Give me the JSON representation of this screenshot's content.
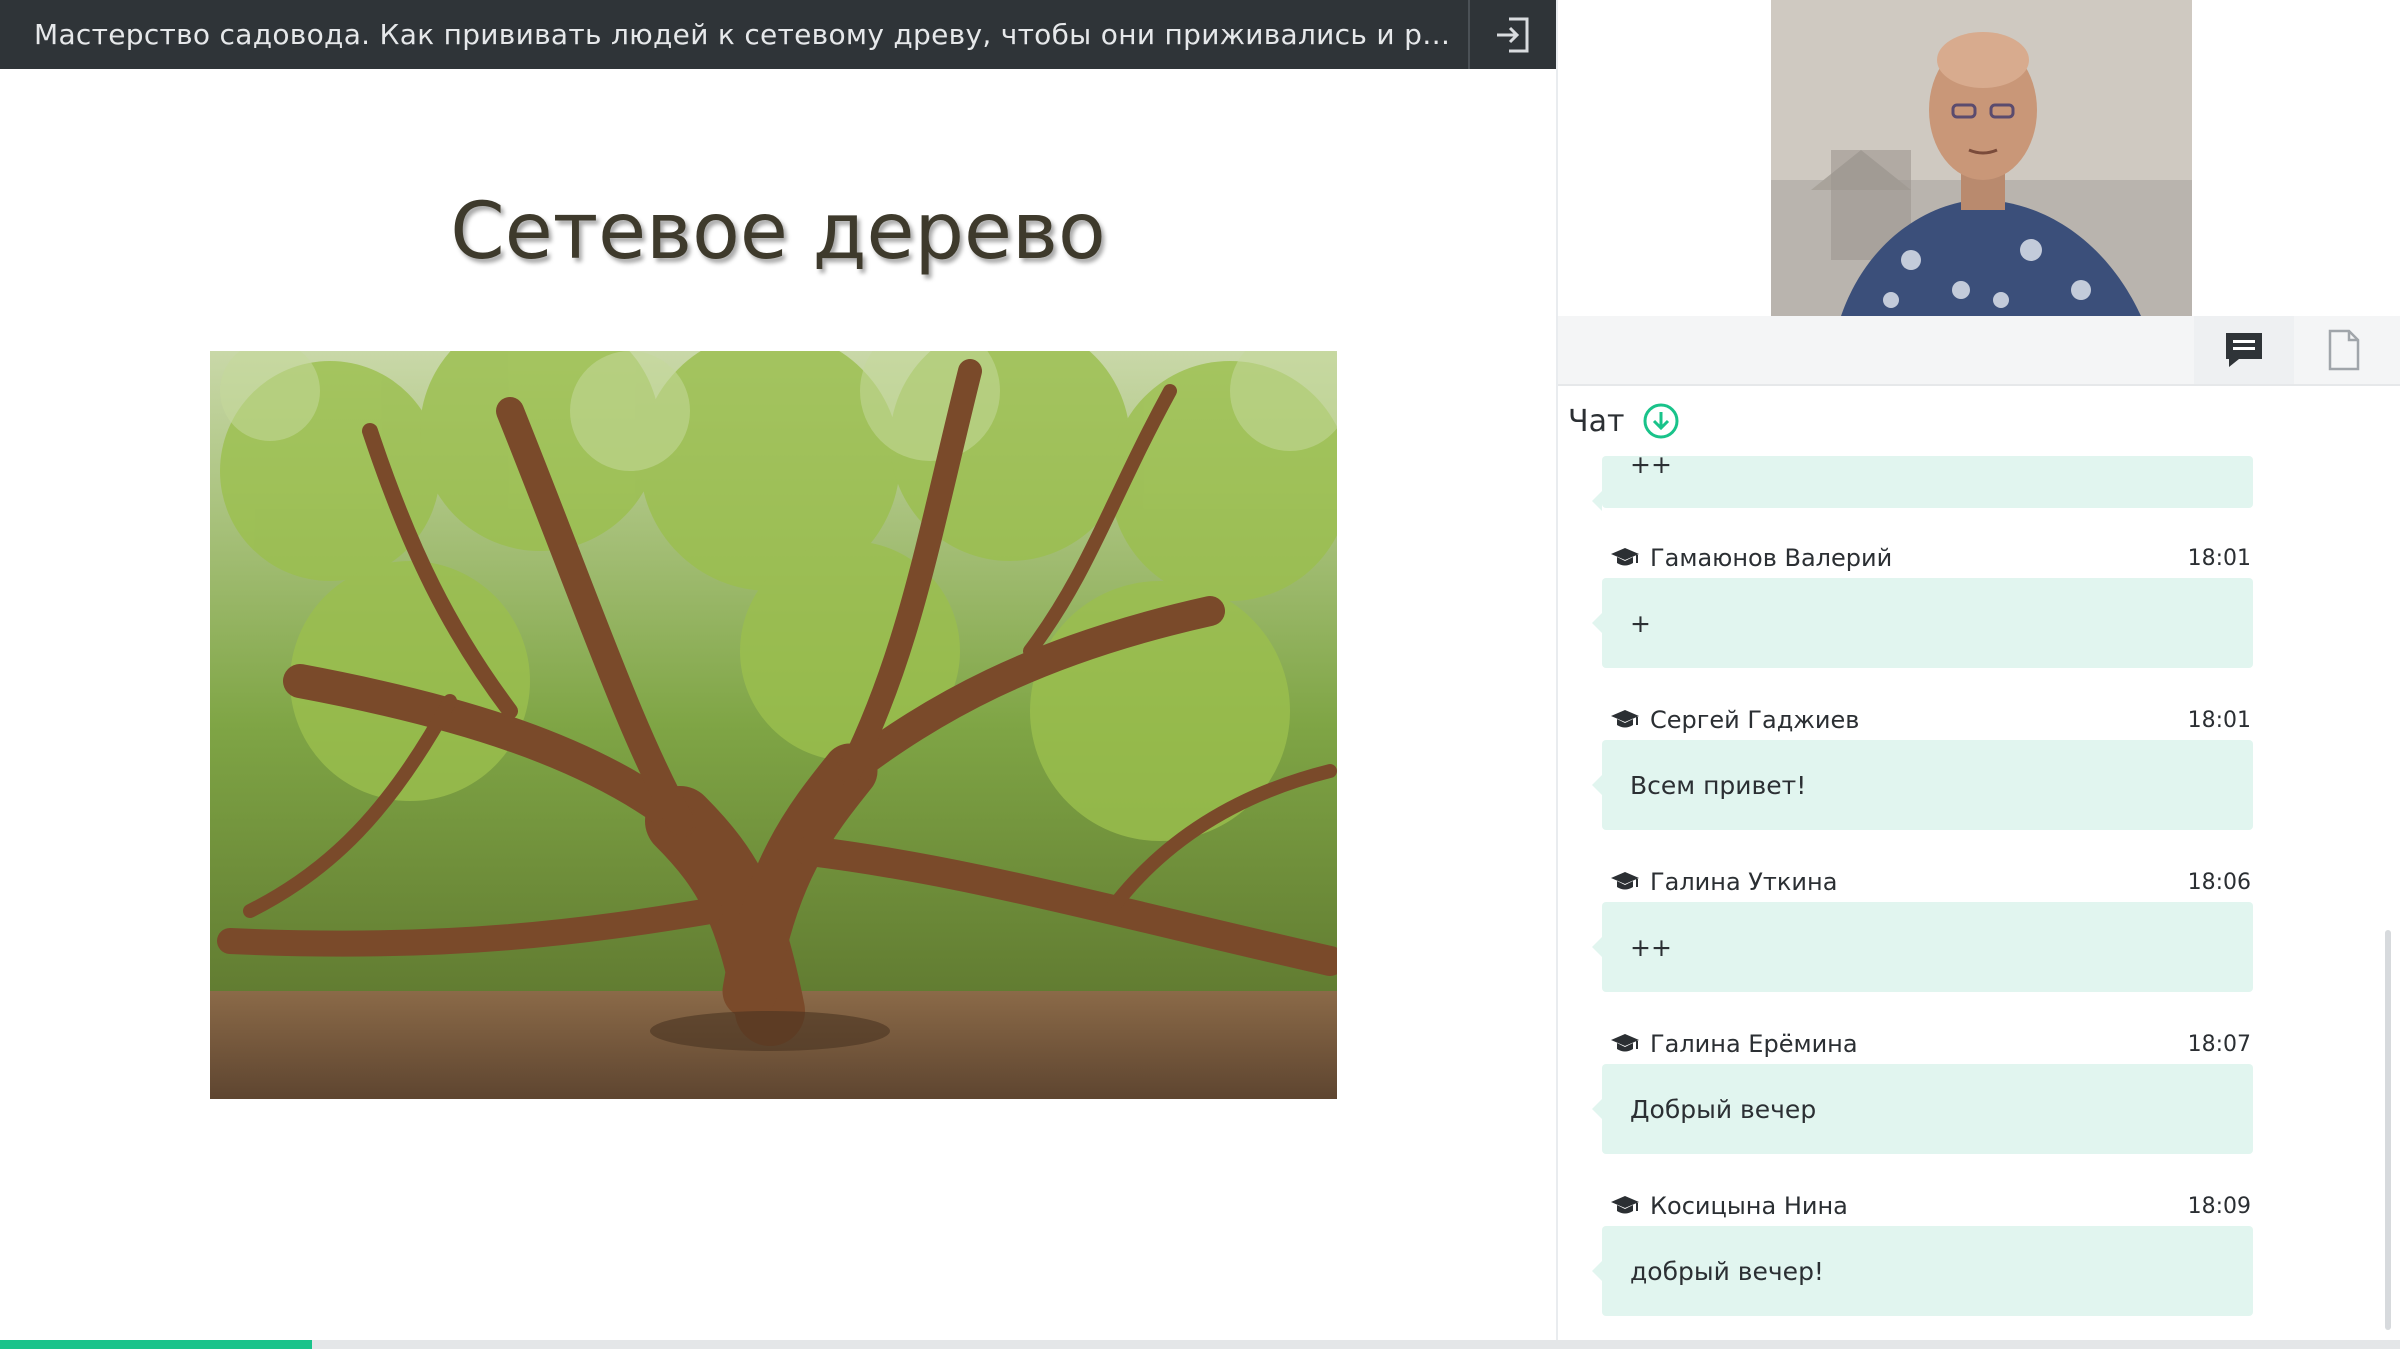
{
  "header": {
    "title": "Мастерство садовода. Как прививать людей к сетевому древу, чтобы они приживались и ра...",
    "exit_icon": "exit-icon"
  },
  "slide": {
    "title": "Сетевое дерево",
    "image": "tree-photo"
  },
  "toolbar": {
    "chat_icon": "chat-icon",
    "files_icon": "file-icon"
  },
  "chat": {
    "label": "Чат",
    "download_icon": "download-icon",
    "partial_message": "++",
    "messages": [
      {
        "author": "Гамаюнов Валерий",
        "time": "18:01",
        "text": "+"
      },
      {
        "author": "Сергей Гаджиев",
        "time": "18:01",
        "text": "Всем привет!"
      },
      {
        "author": "Галина Уткина",
        "time": "18:06",
        "text": "++"
      },
      {
        "author": "Галина Ерёмина",
        "time": "18:07",
        "text": "Добрый вечер"
      },
      {
        "author": "Косицына Нина",
        "time": "18:09",
        "text": "добрый вечер!"
      }
    ]
  },
  "progress": {
    "value": 0.13
  },
  "colors": {
    "accent": "#19c38a",
    "bubble": "#e1f5ef",
    "header_bg": "#2f3438"
  }
}
